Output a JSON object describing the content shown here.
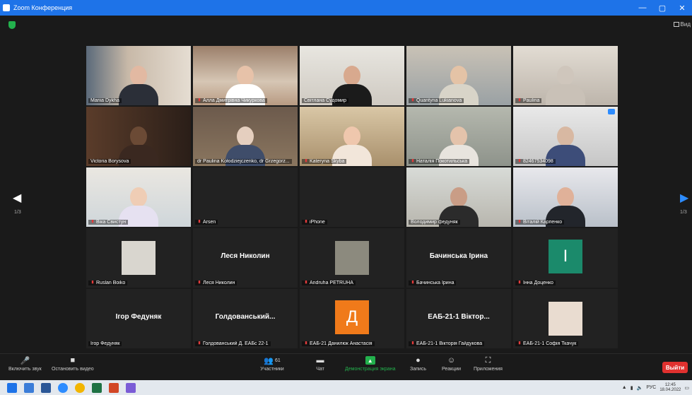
{
  "window": {
    "title": "Zoom Конференция"
  },
  "view": {
    "label": "Вид"
  },
  "pagination": {
    "left": "1/3",
    "right": "1/3"
  },
  "participants": [
    {
      "name": "Mariia Dykha",
      "type": "video",
      "muted": false,
      "scene": "bg-room1",
      "skin": "#e2b9a2",
      "shirt": "#2b2f38"
    },
    {
      "name": "Алла Дмитрівна Чикуркова",
      "type": "video",
      "muted": true,
      "scene": "bg-room2",
      "skin": "#e7c2a9",
      "shirt": "#ffffff"
    },
    {
      "name": "Світлана Судомир",
      "type": "video",
      "muted": false,
      "scene": "bg-room3",
      "skin": "#d8a98e",
      "shirt": "#1b1b1b"
    },
    {
      "name": "Quantyna Lukianova",
      "type": "video",
      "muted": true,
      "scene": "bg-room4",
      "skin": "#e4c3a6",
      "shirt": "#d8d4c8"
    },
    {
      "name": "Paulina",
      "type": "video",
      "muted": true,
      "scene": "bg-room5",
      "skin": "#cfc6bc",
      "shirt": "#c9c1b7"
    },
    {
      "name": "Victoria Borysova",
      "type": "video",
      "muted": false,
      "scene": "bg-room6",
      "skin": "#6b4a35",
      "shirt": "#3a2820"
    },
    {
      "name": "dr Paulina Kołodziejczenko, dr Grzegorz...",
      "type": "video",
      "muted": false,
      "active": true,
      "scene": "bg-room7",
      "skin": "#e5cfbf",
      "shirt": "#3f4d6a"
    },
    {
      "name": "Kateryna Skyba",
      "type": "video",
      "muted": true,
      "scene": "bg-room8",
      "skin": "#efc7ad",
      "shirt": "#f2e6da"
    },
    {
      "name": "Наталія Покотильська",
      "type": "video",
      "muted": true,
      "scene": "bg-room9",
      "skin": "#e4c3ab",
      "shirt": "#e8e4de"
    },
    {
      "name": "82467534098",
      "type": "video",
      "muted": true,
      "scene": "bg-room10",
      "skin": "#d8b8a2",
      "shirt": "#3d4d79",
      "badge": true
    },
    {
      "name": "Віка Свистун",
      "type": "video",
      "muted": true,
      "scene": "bg-room11",
      "skin": "#efcdb5",
      "shirt": "#e6e1f1"
    },
    {
      "name": "Arsen",
      "type": "blank",
      "muted": true
    },
    {
      "name": "iPhone",
      "type": "blank",
      "muted": true
    },
    {
      "name": "Володимир федуняк",
      "type": "video",
      "muted": false,
      "scene": "bg-room12",
      "skin": "#c99d86",
      "shirt": "#2b2b2b"
    },
    {
      "name": "Віталій Карпенко",
      "type": "video",
      "muted": true,
      "scene": "bg-room13",
      "skin": "#e0b199",
      "shirt": "#22252b"
    },
    {
      "name": "Ruslan Boiko",
      "type": "photo",
      "muted": true,
      "photo_color": "#d9d6cf"
    },
    {
      "name": "Леся Николин",
      "type": "text",
      "muted": true,
      "big": "Леся Николин"
    },
    {
      "name": "Andruha PETRUHA",
      "type": "photo",
      "muted": true,
      "photo_color": "#8c8a7e"
    },
    {
      "name": "Бачинська Ірина",
      "type": "text",
      "muted": true,
      "big": "Бачинська Ірина"
    },
    {
      "name": "Інна Доценко",
      "type": "letter",
      "muted": true,
      "letter": "I",
      "color": "#1b8a6b"
    },
    {
      "name": "Ігор Федуняк",
      "type": "text",
      "muted": false,
      "big": "Ігор Федуняк"
    },
    {
      "name": "Голдованський Д. ЕАБс 22-1",
      "type": "text",
      "muted": true,
      "big": "Голдованський..."
    },
    {
      "name": "ЕАБ-21 Данилюк Анастасія",
      "type": "letter",
      "muted": true,
      "letter": "Д",
      "color": "#f07a1a"
    },
    {
      "name": "ЕАБ-21-1 Вікторія Гайдукова",
      "type": "text",
      "muted": true,
      "big": "ЕАБ-21-1 Віктор..."
    },
    {
      "name": "ЕАБ-21-1 Софія Ткачук",
      "type": "photo",
      "muted": true,
      "photo_color": "#e9dcd0"
    }
  ],
  "toolbar": {
    "mic": "Включить звук",
    "video": "Остановить видео",
    "participants": "Участники",
    "participants_count": "61",
    "chat": "Чат",
    "share": "Демонстрация экрана",
    "record": "Запись",
    "reactions": "Реакции",
    "apps": "Приложения",
    "leave": "Выйти"
  },
  "taskbar": {
    "lang": "РУС",
    "time": "12:45",
    "date": "18.04.2022"
  },
  "colors": {
    "accent": "#2d8cff",
    "leave": "#e0312f",
    "share": "#23b14d",
    "titlebar": "#1e73e8"
  }
}
